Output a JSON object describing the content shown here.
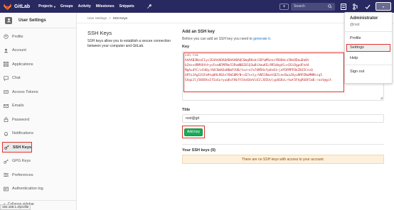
{
  "navbar": {
    "brand": "GitLab",
    "links": [
      "Projects",
      "Groups",
      "Activity",
      "Milestones",
      "Snippets"
    ],
    "search_placeholder": "Search",
    "avatar_caret": "▾"
  },
  "sidebar": {
    "header_title": "User Settings",
    "items": [
      {
        "label": "Profile",
        "icon": "profile-icon"
      },
      {
        "label": "Account",
        "icon": "account-icon"
      },
      {
        "label": "Applications",
        "icon": "applications-icon"
      },
      {
        "label": "Chat",
        "icon": "chat-icon"
      },
      {
        "label": "Access Tokens",
        "icon": "token-icon"
      },
      {
        "label": "Emails",
        "icon": "email-icon"
      },
      {
        "label": "Password",
        "icon": "lock-icon"
      },
      {
        "label": "Notifications",
        "icon": "bell-icon"
      },
      {
        "label": "SSH Keys",
        "icon": "key-icon"
      },
      {
        "label": "GPG Keys",
        "icon": "key-icon"
      },
      {
        "label": "Preferences",
        "icon": "preferences-icon"
      },
      {
        "label": "Authentication log",
        "icon": "log-icon"
      }
    ],
    "collapse_label": "Collapse sidebar",
    "status_url": "192.168.1.4/profile"
  },
  "breadcrumb": {
    "parent": "User Settings",
    "separator": ">",
    "current": "SSH Keys"
  },
  "ssh": {
    "title": "SSH Keys",
    "description": "SSH keys allow you to establish a secure connection between your computer and GitLab.",
    "add_title": "Add an SSH key",
    "intro_prefix": "Before you can add an SSH key you need to ",
    "intro_link": "generate it.",
    "key_label": "Key",
    "key_value": "ssh-rsa\nAAAAB3NzaC1yc2EAAAADAQABAAABAQC0mgR8sbiSDfqMSenzfRO8dcz5NvDDauDa0t\nb2knv4RMXOtH+yxFeaN5MFNe52RoWB8Z61Q3wBiXmuKEL9R5dbg4Cu+E6iDgpdFed4\nMgAudYC/xCH8y/AUCNeK6oNDmPJUB/toz+e7a7UM5Hzfp8v81+jdfDFMPFDkIN15CnvQ\nU9ToJAgIO1Fm9tq09LR6Sn76W10M/N+s67snly/VN51RmetQE5im+BuoZUyuRRPZNoMNMsiq5\nSXqoJlj58SRXsIfIoGuryuqKcFHb7t54n6XeVi61lJOIUvlyp6G8cL+hwt5FkgRS0FCmD:root@git",
    "title_label": "Title",
    "title_value": "root@git",
    "add_button": "Add key",
    "your_keys": "Your SSH keys (0)",
    "empty_message": "There are no SSH keys with access to your account."
  },
  "dropdown": {
    "name": "Administrator",
    "username": "@root",
    "items": [
      "Profile",
      "Settings",
      "Help",
      "Sign out"
    ]
  },
  "colors": {
    "navbar": "#292961",
    "highlight": "#e0332c",
    "primary_button": "#1aaa55",
    "link": "#1f78d1"
  }
}
